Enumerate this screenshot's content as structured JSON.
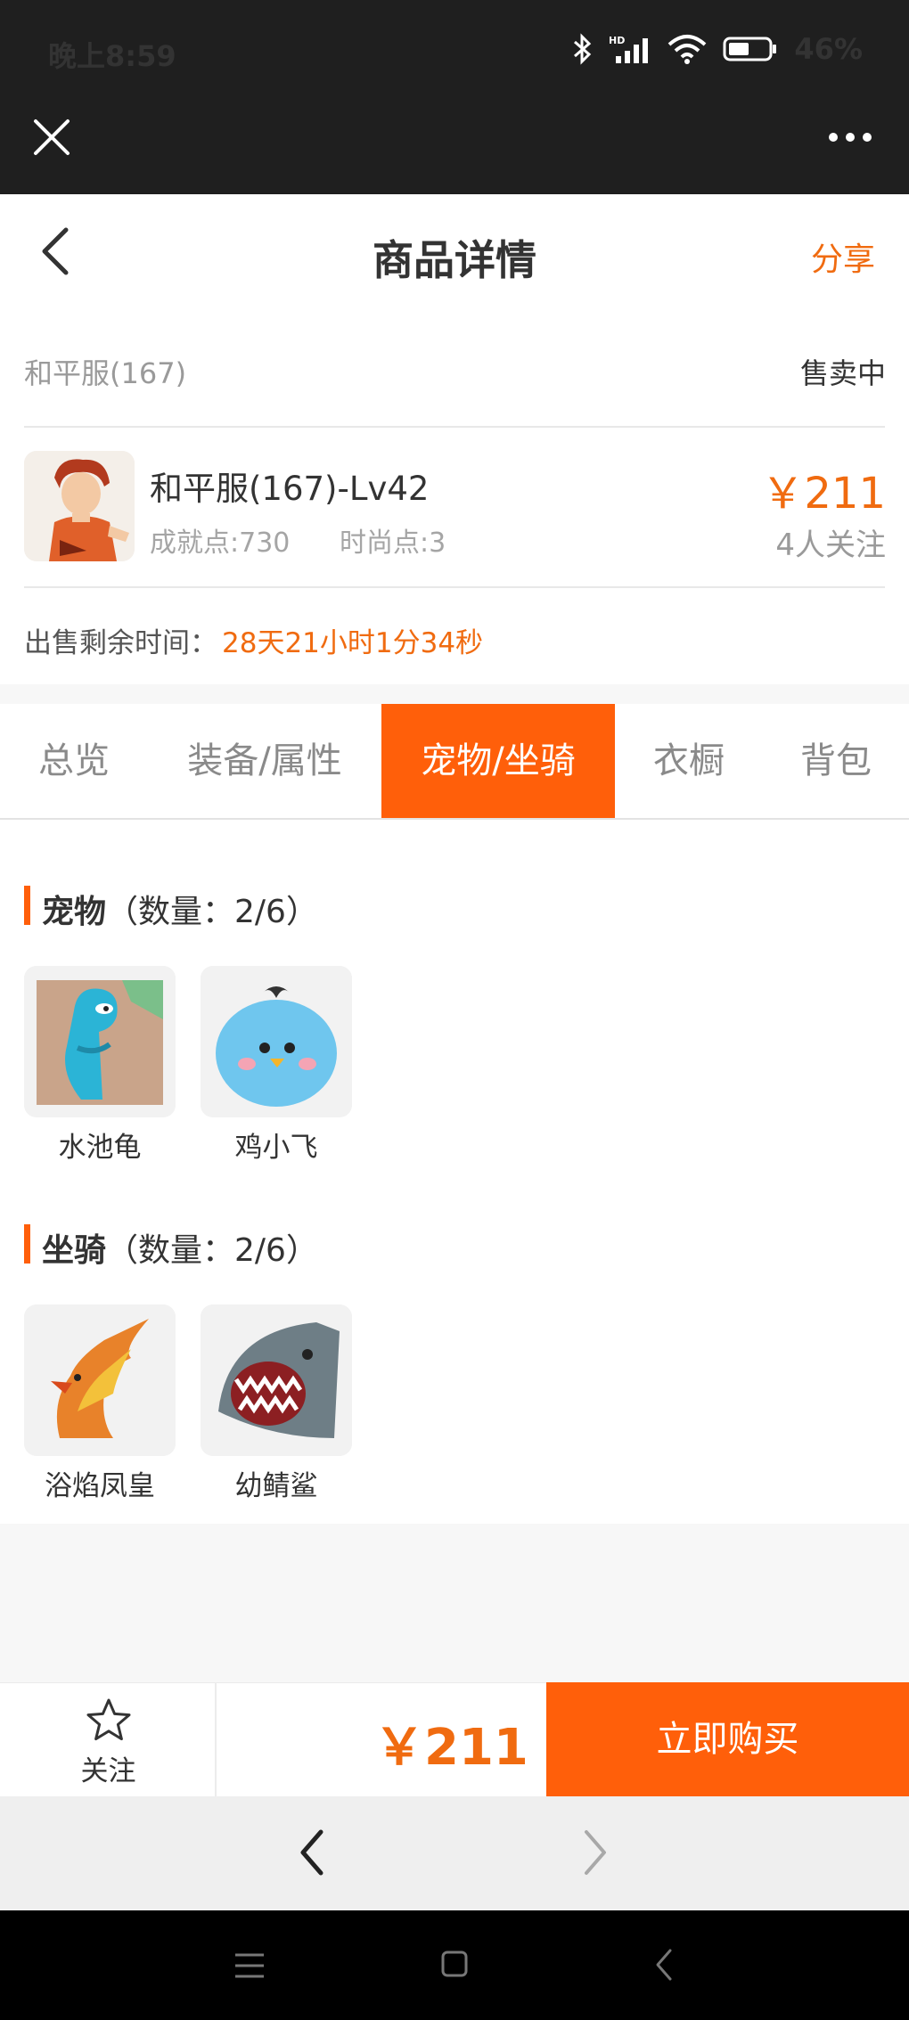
{
  "status_bar": {
    "time": "晚上8:59",
    "battery_percent": "46%",
    "icons": [
      "bluetooth-icon",
      "hd-signal-icon",
      "wifi-icon",
      "battery-icon"
    ]
  },
  "webview": {
    "close_icon": "close-icon",
    "more_icon": "more-dots-icon"
  },
  "nav": {
    "title": "商品详情",
    "share": "分享"
  },
  "product": {
    "server": "和平服(167)",
    "status": "售卖中",
    "name": "和平服(167)-Lv42",
    "achievement": "成就点:730",
    "fashion": "时尚点:3",
    "price": "￥211",
    "followers": "4人关注",
    "remain_label": "出售剩余时间：",
    "remain_value": "28天21小时1分34秒"
  },
  "tabs": [
    {
      "label": "总览",
      "active": false
    },
    {
      "label": "装备/属性",
      "active": false
    },
    {
      "label": "宠物/坐骑",
      "active": true
    },
    {
      "label": "衣橱",
      "active": false
    },
    {
      "label": "背包",
      "active": false
    }
  ],
  "pets": {
    "title": "宠物",
    "count": "（数量：2/6）",
    "items": [
      {
        "name": "水池龟"
      },
      {
        "name": "鸡小飞"
      }
    ]
  },
  "mounts": {
    "title": "坐骑",
    "count": "（数量：2/6）",
    "items": [
      {
        "name": "浴焰凤皇"
      },
      {
        "name": "幼鲭鲨"
      }
    ]
  },
  "bottom": {
    "follow_label": "关注",
    "price": "￥211",
    "buy_label": "立即购买"
  },
  "colors": {
    "accent": "#ff5f0a",
    "price": "#f06b10",
    "dark_bar": "#1f1f1f"
  }
}
